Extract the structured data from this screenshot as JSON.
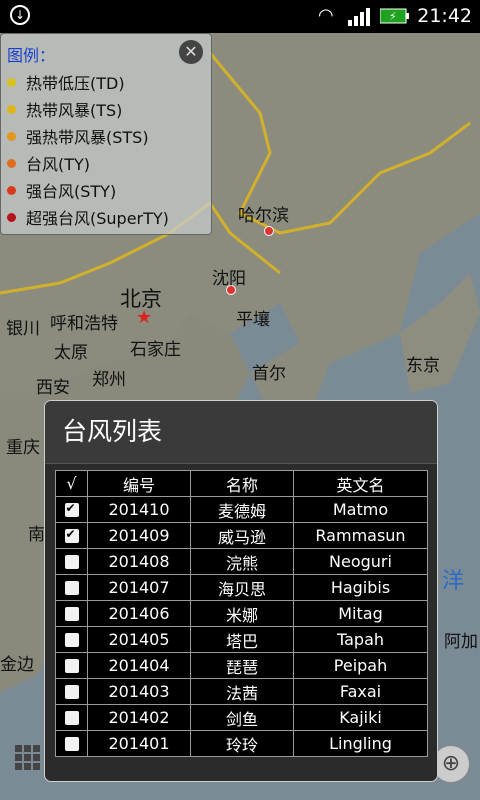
{
  "status_bar": {
    "time": "21:42"
  },
  "legend": {
    "title": "图例：",
    "items": [
      {
        "label": "热带低压(TD)",
        "color": "#d9c21f"
      },
      {
        "label": "热带风暴(TS)",
        "color": "#e0b51a"
      },
      {
        "label": "强热带风暴(STS)",
        "color": "#e39720"
      },
      {
        "label": "台风(TY)",
        "color": "#e06d1e"
      },
      {
        "label": "强台风(STY)",
        "color": "#d83a1c"
      },
      {
        "label": "超强台风(SuperTY)",
        "color": "#b5141a"
      }
    ]
  },
  "map_labels": [
    {
      "text": "哈尔滨",
      "size": "normal"
    },
    {
      "text": "沈阳",
      "size": "normal"
    },
    {
      "text": "北京",
      "size": "big"
    },
    {
      "text": "呼和浩特",
      "size": "normal"
    },
    {
      "text": "银川",
      "size": "normal"
    },
    {
      "text": "太原",
      "size": "normal"
    },
    {
      "text": "石家庄",
      "size": "normal"
    },
    {
      "text": "平壤",
      "size": "normal"
    },
    {
      "text": "首尔",
      "size": "normal"
    },
    {
      "text": "东京",
      "size": "normal"
    },
    {
      "text": "西安",
      "size": "normal"
    },
    {
      "text": "郑州",
      "size": "normal"
    },
    {
      "text": "重庆",
      "size": "normal"
    },
    {
      "text": "南",
      "size": "normal"
    },
    {
      "text": "洋",
      "size": "sea"
    },
    {
      "text": "阿加",
      "size": "normal"
    },
    {
      "text": "金边",
      "size": "normal"
    }
  ],
  "dialog": {
    "title": "台风列表",
    "columns": [
      "√",
      "编号",
      "名称",
      "英文名"
    ],
    "rows": [
      {
        "checked": true,
        "id": "201410",
        "name": "麦德姆",
        "en": "Matmo"
      },
      {
        "checked": true,
        "id": "201409",
        "name": "威马逊",
        "en": "Rammasun"
      },
      {
        "checked": false,
        "id": "201408",
        "name": "浣熊",
        "en": "Neoguri"
      },
      {
        "checked": false,
        "id": "201407",
        "name": "海贝思",
        "en": "Hagibis"
      },
      {
        "checked": false,
        "id": "201406",
        "name": "米娜",
        "en": "Mitag"
      },
      {
        "checked": false,
        "id": "201405",
        "name": "塔巴",
        "en": "Tapah"
      },
      {
        "checked": false,
        "id": "201404",
        "name": "琵琶",
        "en": "Peipah"
      },
      {
        "checked": false,
        "id": "201403",
        "name": "法茜",
        "en": "Faxai"
      },
      {
        "checked": false,
        "id": "201402",
        "name": "剑鱼",
        "en": "Kajiki"
      },
      {
        "checked": false,
        "id": "201401",
        "name": "玲玲",
        "en": "Lingling"
      }
    ]
  }
}
